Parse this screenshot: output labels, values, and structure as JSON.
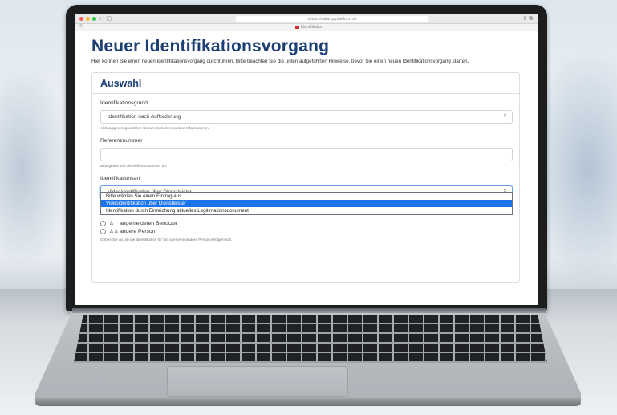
{
  "browser": {
    "url": "st.buchhaltungsplattform.de",
    "tab_title": "Identifikation",
    "colors": {
      "close": "#ff5f57",
      "minimize": "#febc2e",
      "maximize": "#28c840"
    }
  },
  "page": {
    "title": "Neuer Identifikationsvorgang",
    "intro": "Hier können Sie einen neuen Identifikationsvorgang durchführen. Bitte beachten Sie die unten aufgeführten Hinweise, bevor Sie einen neuen Identifikationsvorgang starten."
  },
  "card": {
    "title": "Auswahl",
    "reason": {
      "label": "Identifikationsgrund",
      "value": "Identifikation nach Aufforderung",
      "help": "Abhängig vom gewählten Grund erscheinen weitere Informationen."
    },
    "reference": {
      "label": "Referenznummer",
      "value": "",
      "help": "Bitte geben Sie die Referenznummer an."
    },
    "type": {
      "label": "Identifikationsart",
      "value": "Videoidentifikation über Dienstleister",
      "options": [
        "Bitte wählen Sie einen Eintrag aus.",
        "Videoidentifikation über Dienstleister",
        "Identifikation durch Einreichung aktuelles Legitimationsdokument"
      ],
      "selected_index": 1
    },
    "person": {
      "options": [
        "angemeldeten Benutzer",
        "andere Person"
      ],
      "help": "Geben Sie an, ob die Identifikation für Sie oder eine andere Person erfolgen soll."
    }
  },
  "accent_color": "#1b3f74",
  "selection_color": "#1a73e8"
}
